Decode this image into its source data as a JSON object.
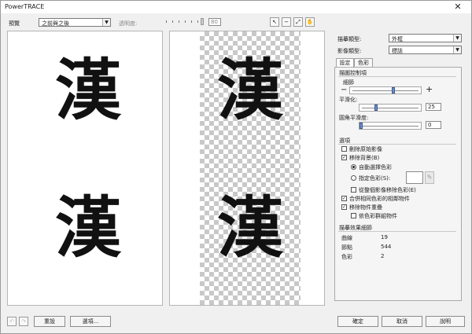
{
  "window": {
    "title": "PowerTRACE",
    "close_glyph": "✕"
  },
  "toolbar": {
    "preview_label": "預覽",
    "preview_select": "之前與之後",
    "transparency_label": "透明度:",
    "transparency_value": "80",
    "tools": [
      "pointer-icon",
      "zoom-out-icon",
      "fit-icon",
      "pan-icon"
    ]
  },
  "images": {
    "glyph_top": "漢",
    "glyph_bottom": "漢",
    "checker_top": "漢",
    "checker_bottom": "漢"
  },
  "right_panel": {
    "trace_type_label": "描摹類型:",
    "trace_type_value": "外框",
    "image_type_label": "影像類型:",
    "image_type_value": "標誌",
    "tabs": [
      "設定",
      "色彩"
    ],
    "trace_controls_title": "描圖控制項",
    "detail_label": "細節",
    "detail_minus": "−",
    "detail_plus": "+",
    "detail_level": 0.62,
    "smoothing_label": "平滑化:",
    "smoothing_value": "25",
    "smoothing_level": 0.25,
    "corner_label": "圓角平滑度:",
    "corner_value": "0",
    "corner_level": 0.0,
    "options_title": "選項",
    "options": [
      {
        "label": "刪除原始影像",
        "checked": false
      },
      {
        "label": "移除背景(B)",
        "checked": true
      }
    ],
    "auto_color_label": "自動選擇色彩",
    "specify_color_label": "指定色彩(S):",
    "remove_from_image_label": "從整個影像移除色彩(E)",
    "merge_adjacent_label": "合併相同色彩的相鄰物件",
    "merge_adjacent_checked": true,
    "remove_overlap_label": "移除物件重疊",
    "remove_overlap_checked": true,
    "group_color_label": "依色彩群組物件",
    "group_color_checked": false,
    "results_title": "描摹效果細節",
    "results": [
      {
        "label": "曲線",
        "value": "19"
      },
      {
        "label": "節點",
        "value": "544"
      },
      {
        "label": "色彩",
        "value": "2"
      }
    ]
  },
  "bottom": {
    "reset_label": "重設",
    "options_label": "選項...",
    "ok_label": "確定",
    "cancel_label": "取消",
    "help_label": "說明"
  },
  "colors": {
    "accent": "#6b8fc9"
  }
}
